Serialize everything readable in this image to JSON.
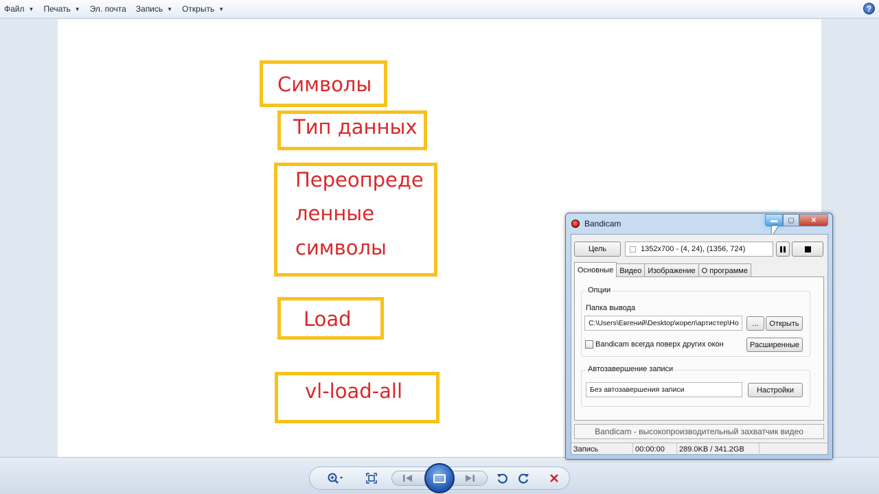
{
  "menubar": {
    "items": [
      {
        "label": "Файл",
        "has_dropdown": true
      },
      {
        "label": "Печать",
        "has_dropdown": true
      },
      {
        "label": "Эл. почта",
        "has_dropdown": false
      },
      {
        "label": "Запись",
        "has_dropdown": true
      },
      {
        "label": "Открыть",
        "has_dropdown": true
      }
    ],
    "help_icon": "?"
  },
  "image": {
    "words": [
      "Символы",
      "Тип данных",
      "Переопреде",
      "ленные",
      "символы",
      "Load",
      "vl-load-all"
    ],
    "box_color": "#f7c21c",
    "text_color": "#d9292b"
  },
  "bandicam": {
    "title": "Bandicam",
    "target_button": "Цель",
    "region": "1352x700 - (4, 24), (1356, 724)",
    "tabs": [
      "Основные",
      "Видео",
      "Изображение",
      "О программе"
    ],
    "options_group": "Опции",
    "output_folder_label": "Папка вывода",
    "output_folder_value": "C:\\Users\\Евгений\\Desktop\\корел\\артистер\\Но",
    "browse_button": "...",
    "open_button": "Открыть",
    "always_on_top_label": "Bandicam всегда поверх других окон",
    "always_on_top_checked": false,
    "advanced_button": "Расширенные",
    "autostop_group": "Автозавершение записи",
    "autostop_value": "Без автозавершения записи",
    "settings_button": "Настройки",
    "banner": "Bandicam - высокопроизводительный захватчик видео",
    "status": {
      "state": "Запись",
      "time": "00:00:00",
      "size": "289.0KB / 341.2GB"
    }
  },
  "icons": {
    "zoom": "zoom-icon",
    "fit": "fit-to-window-icon",
    "prev": "previous-icon",
    "slideshow": "slideshow-icon",
    "next": "next-icon",
    "rotate_ccw": "rotate-counterclockwise-icon",
    "rotate_cw": "rotate-clockwise-icon",
    "delete": "delete-icon"
  }
}
